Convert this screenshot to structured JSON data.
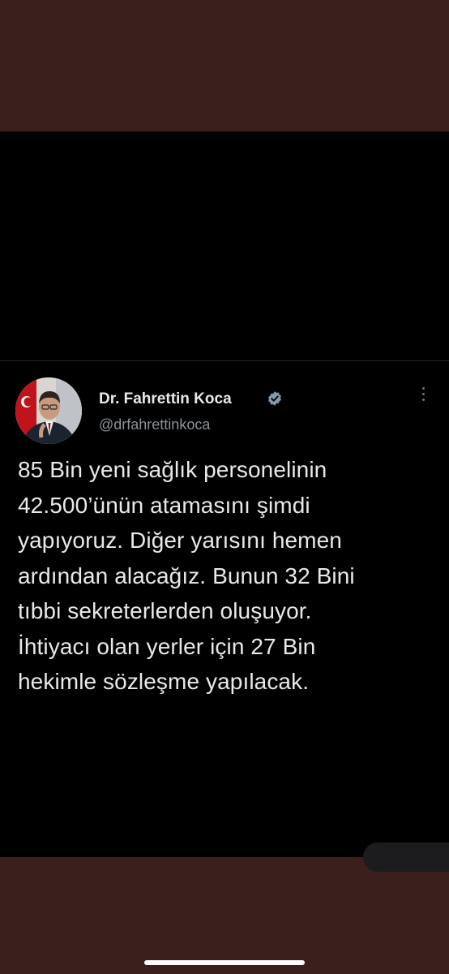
{
  "tweet": {
    "author": {
      "display_name": "Dr. Fahrettin Koca",
      "handle": "@drfahrettinkoca",
      "verified": true,
      "avatar_icon": "profile-photo"
    },
    "text_lines": [
      "85 Bin yeni sağlık personelinin",
      "42.500’ünün atamasını şimdi",
      "yapıyoruz. Diğer yarısını hemen",
      "ardından alacağız. Bunun 32 Bini",
      "tıbbi sekreterlerden oluşuyor.",
      "İhtiyacı olan yerler için 27 Bin",
      "hekimle sözleşme yapılacak."
    ],
    "more_icon": "more-vertical-icon"
  },
  "colors": {
    "frame_background": "#3a1f1c",
    "screen_background": "#000000",
    "text_primary": "#e7e9ea",
    "text_secondary": "#8b9197",
    "verified_badge": "#829aab"
  }
}
